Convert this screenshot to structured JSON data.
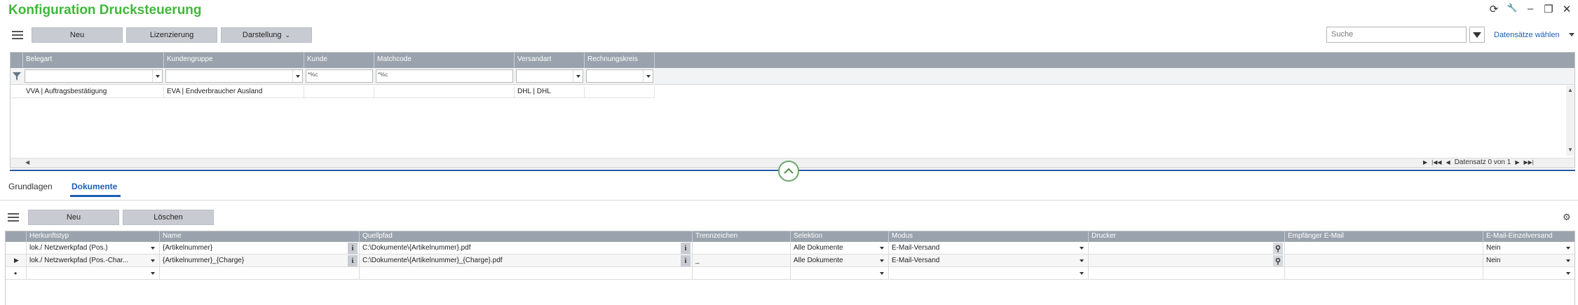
{
  "app": {
    "title": "Konfiguration Drucksteuerung"
  },
  "window_controls": [
    {
      "name": "refresh-icon",
      "glyph": "⟳"
    },
    {
      "name": "wrench-icon",
      "glyph": "🔧"
    },
    {
      "name": "minimize-icon",
      "glyph": "–"
    },
    {
      "name": "restore-icon",
      "glyph": "❐"
    },
    {
      "name": "close-icon",
      "glyph": "✕"
    }
  ],
  "toolbar": {
    "new_label": "Neu",
    "license_label": "Lizenzierung",
    "view_label": "Darstellung"
  },
  "search": {
    "placeholder": "Suche",
    "records_label": "Datensätze wählen"
  },
  "grid1": {
    "columns": [
      "Belegart",
      "Kundengruppe",
      "Kunde",
      "Matchcode",
      "Versandart",
      "Rechnungskreis"
    ],
    "filter_prefix": "*%c",
    "rows": [
      {
        "belegart": "VVA  |  Auftragsbestätigung",
        "kundengruppe": "EVA  |  Endverbraucher Ausland",
        "kunde": "",
        "matchcode": "",
        "versandart": "DHL  |  DHL",
        "rechnungskreis": ""
      }
    ],
    "pager": "Datensatz 0 von 1"
  },
  "tabs": [
    "Grundlagen",
    "Dokumente"
  ],
  "active_tab": "Dokumente",
  "doc_toolbar": {
    "new_label": "Neu",
    "delete_label": "Löschen"
  },
  "grid2": {
    "columns": [
      "Herkunftstyp",
      "Name",
      "Quellpfad",
      "Trennzeichen",
      "Selektion",
      "Modus",
      "Drucker",
      "Empfänger E-Mail",
      "E-Mail-Einzelversand"
    ],
    "rows": [
      {
        "herkunftstyp": "lok./ Netzwerkpfad (Pos.)",
        "name": "{Artikelnummer}",
        "quellpfad": "C:\\Dokumente\\{Artikelnummer}.pdf",
        "trennzeichen": "",
        "selektion": "Alle Dokumente",
        "modus": "E-Mail-Versand",
        "drucker": "",
        "empfaenger": "",
        "einzelversand": "Nein"
      },
      {
        "herkunftstyp": "lok./ Netzwerkpfad (Pos.-Char...",
        "name": "{Artikelnummer}_{Charge}",
        "quellpfad": "C:\\Dokumente\\{Artikelnummer}_{Charge}.pdf",
        "trennzeichen": "_",
        "selektion": "Alle Dokumente",
        "modus": "E-Mail-Versand",
        "drucker": "",
        "empfaenger": "",
        "einzelversand": "Nein"
      }
    ]
  }
}
